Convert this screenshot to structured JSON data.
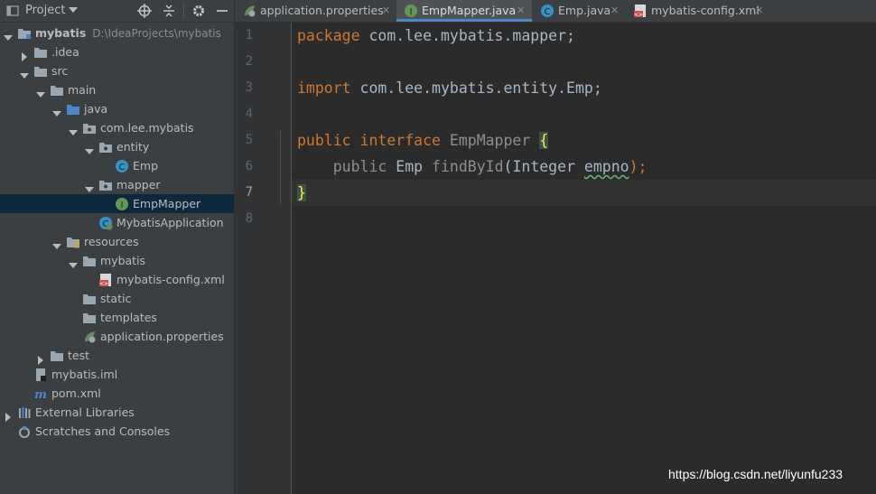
{
  "panel": {
    "title": "Project"
  },
  "tree": {
    "root": {
      "name": "mybatis",
      "path": "D:\\IdeaProjects\\mybatis"
    },
    "idea": ".idea",
    "src": "src",
    "main": "main",
    "java": "java",
    "package": "com.lee.mybatis",
    "entity": "entity",
    "emp": "Emp",
    "mapper": "mapper",
    "emp_mapper": "EmpMapper",
    "mybatis_application": "MybatisApplication",
    "resources": "resources",
    "mybatis_dir": "mybatis",
    "mybatis_config": "mybatis-config.xml",
    "static": "static",
    "templates": "templates",
    "application_properties": "application.properties",
    "test": "test",
    "mybatis_iml": "mybatis.iml",
    "pom": "pom.xml",
    "external_libraries": "External Libraries",
    "scratches": "Scratches and Consoles"
  },
  "tabs": [
    {
      "label": "application.properties",
      "icon": "spring-properties-icon"
    },
    {
      "label": "EmpMapper.java",
      "icon": "interface-icon",
      "active": true
    },
    {
      "label": "Emp.java",
      "icon": "class-icon"
    },
    {
      "label": "mybatis-config.xml",
      "icon": "xml-icon"
    }
  ],
  "editor": {
    "line_numbers": [
      "1",
      "2",
      "3",
      "4",
      "5",
      "6",
      "7",
      "8"
    ],
    "current_line": 7,
    "code": {
      "l1_kw": "package",
      "l1_rest": " com.lee.mybatis.mapper;",
      "l3_kw": "import",
      "l3_rest": " com.lee.mybatis.entity.Emp;",
      "l5_kw": "public interface",
      "l5_name": " EmpMapper ",
      "l5_brace": "{",
      "l6_indent": "    ",
      "l6_public": "public",
      "l6_type": " Emp ",
      "l6_method": "findById",
      "l6_paren": "(Integer ",
      "l6_param": "empno",
      "l6_end": ");",
      "l7_brace": "}"
    }
  },
  "watermark": "https://blog.csdn.net/liyunfu233",
  "colors": {
    "keyword": "#cc7832",
    "text": "#a9b7c6",
    "background": "#2b2b2b",
    "selection": "#0d293e",
    "active_tab_underline": "#4a88c7"
  }
}
